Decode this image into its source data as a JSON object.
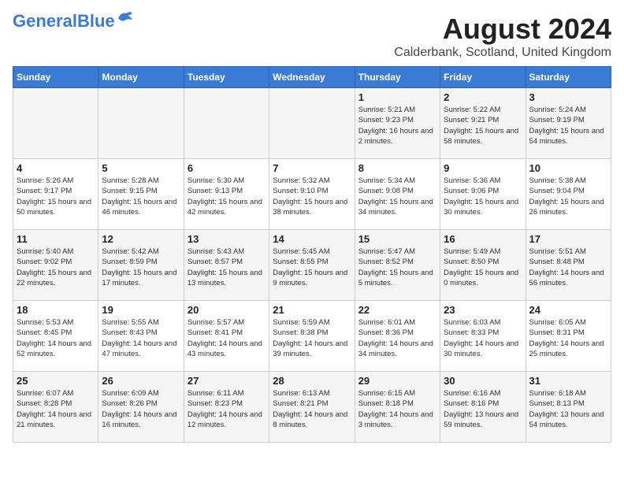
{
  "header": {
    "logo_general": "General",
    "logo_blue": "Blue",
    "month_title": "August 2024",
    "location": "Calderbank, Scotland, United Kingdom"
  },
  "weekdays": [
    "Sunday",
    "Monday",
    "Tuesday",
    "Wednesday",
    "Thursday",
    "Friday",
    "Saturday"
  ],
  "weeks": [
    [
      {
        "day": "",
        "sunrise": "",
        "sunset": "",
        "daylight": ""
      },
      {
        "day": "",
        "sunrise": "",
        "sunset": "",
        "daylight": ""
      },
      {
        "day": "",
        "sunrise": "",
        "sunset": "",
        "daylight": ""
      },
      {
        "day": "",
        "sunrise": "",
        "sunset": "",
        "daylight": ""
      },
      {
        "day": "1",
        "sunrise": "Sunrise: 5:21 AM",
        "sunset": "Sunset: 9:23 PM",
        "daylight": "Daylight: 16 hours and 2 minutes."
      },
      {
        "day": "2",
        "sunrise": "Sunrise: 5:22 AM",
        "sunset": "Sunset: 9:21 PM",
        "daylight": "Daylight: 15 hours and 58 minutes."
      },
      {
        "day": "3",
        "sunrise": "Sunrise: 5:24 AM",
        "sunset": "Sunset: 9:19 PM",
        "daylight": "Daylight: 15 hours and 54 minutes."
      }
    ],
    [
      {
        "day": "4",
        "sunrise": "Sunrise: 5:26 AM",
        "sunset": "Sunset: 9:17 PM",
        "daylight": "Daylight: 15 hours and 50 minutes."
      },
      {
        "day": "5",
        "sunrise": "Sunrise: 5:28 AM",
        "sunset": "Sunset: 9:15 PM",
        "daylight": "Daylight: 15 hours and 46 minutes."
      },
      {
        "day": "6",
        "sunrise": "Sunrise: 5:30 AM",
        "sunset": "Sunset: 9:13 PM",
        "daylight": "Daylight: 15 hours and 42 minutes."
      },
      {
        "day": "7",
        "sunrise": "Sunrise: 5:32 AM",
        "sunset": "Sunset: 9:10 PM",
        "daylight": "Daylight: 15 hours and 38 minutes."
      },
      {
        "day": "8",
        "sunrise": "Sunrise: 5:34 AM",
        "sunset": "Sunset: 9:08 PM",
        "daylight": "Daylight: 15 hours and 34 minutes."
      },
      {
        "day": "9",
        "sunrise": "Sunrise: 5:36 AM",
        "sunset": "Sunset: 9:06 PM",
        "daylight": "Daylight: 15 hours and 30 minutes."
      },
      {
        "day": "10",
        "sunrise": "Sunrise: 5:38 AM",
        "sunset": "Sunset: 9:04 PM",
        "daylight": "Daylight: 15 hours and 26 minutes."
      }
    ],
    [
      {
        "day": "11",
        "sunrise": "Sunrise: 5:40 AM",
        "sunset": "Sunset: 9:02 PM",
        "daylight": "Daylight: 15 hours and 22 minutes."
      },
      {
        "day": "12",
        "sunrise": "Sunrise: 5:42 AM",
        "sunset": "Sunset: 8:59 PM",
        "daylight": "Daylight: 15 hours and 17 minutes."
      },
      {
        "day": "13",
        "sunrise": "Sunrise: 5:43 AM",
        "sunset": "Sunset: 8:57 PM",
        "daylight": "Daylight: 15 hours and 13 minutes."
      },
      {
        "day": "14",
        "sunrise": "Sunrise: 5:45 AM",
        "sunset": "Sunset: 8:55 PM",
        "daylight": "Daylight: 15 hours and 9 minutes."
      },
      {
        "day": "15",
        "sunrise": "Sunrise: 5:47 AM",
        "sunset": "Sunset: 8:52 PM",
        "daylight": "Daylight: 15 hours and 5 minutes."
      },
      {
        "day": "16",
        "sunrise": "Sunrise: 5:49 AM",
        "sunset": "Sunset: 8:50 PM",
        "daylight": "Daylight: 15 hours and 0 minutes."
      },
      {
        "day": "17",
        "sunrise": "Sunrise: 5:51 AM",
        "sunset": "Sunset: 8:48 PM",
        "daylight": "Daylight: 14 hours and 56 minutes."
      }
    ],
    [
      {
        "day": "18",
        "sunrise": "Sunrise: 5:53 AM",
        "sunset": "Sunset: 8:45 PM",
        "daylight": "Daylight: 14 hours and 52 minutes."
      },
      {
        "day": "19",
        "sunrise": "Sunrise: 5:55 AM",
        "sunset": "Sunset: 8:43 PM",
        "daylight": "Daylight: 14 hours and 47 minutes."
      },
      {
        "day": "20",
        "sunrise": "Sunrise: 5:57 AM",
        "sunset": "Sunset: 8:41 PM",
        "daylight": "Daylight: 14 hours and 43 minutes."
      },
      {
        "day": "21",
        "sunrise": "Sunrise: 5:59 AM",
        "sunset": "Sunset: 8:38 PM",
        "daylight": "Daylight: 14 hours and 39 minutes."
      },
      {
        "day": "22",
        "sunrise": "Sunrise: 6:01 AM",
        "sunset": "Sunset: 8:36 PM",
        "daylight": "Daylight: 14 hours and 34 minutes."
      },
      {
        "day": "23",
        "sunrise": "Sunrise: 6:03 AM",
        "sunset": "Sunset: 8:33 PM",
        "daylight": "Daylight: 14 hours and 30 minutes."
      },
      {
        "day": "24",
        "sunrise": "Sunrise: 6:05 AM",
        "sunset": "Sunset: 8:31 PM",
        "daylight": "Daylight: 14 hours and 25 minutes."
      }
    ],
    [
      {
        "day": "25",
        "sunrise": "Sunrise: 6:07 AM",
        "sunset": "Sunset: 8:28 PM",
        "daylight": "Daylight: 14 hours and 21 minutes."
      },
      {
        "day": "26",
        "sunrise": "Sunrise: 6:09 AM",
        "sunset": "Sunset: 8:26 PM",
        "daylight": "Daylight: 14 hours and 16 minutes."
      },
      {
        "day": "27",
        "sunrise": "Sunrise: 6:11 AM",
        "sunset": "Sunset: 8:23 PM",
        "daylight": "Daylight: 14 hours and 12 minutes."
      },
      {
        "day": "28",
        "sunrise": "Sunrise: 6:13 AM",
        "sunset": "Sunset: 8:21 PM",
        "daylight": "Daylight: 14 hours and 8 minutes."
      },
      {
        "day": "29",
        "sunrise": "Sunrise: 6:15 AM",
        "sunset": "Sunset: 8:18 PM",
        "daylight": "Daylight: 14 hours and 3 minutes."
      },
      {
        "day": "30",
        "sunrise": "Sunrise: 6:16 AM",
        "sunset": "Sunset: 8:16 PM",
        "daylight": "Daylight: 13 hours and 59 minutes."
      },
      {
        "day": "31",
        "sunrise": "Sunrise: 6:18 AM",
        "sunset": "Sunset: 8:13 PM",
        "daylight": "Daylight: 13 hours and 54 minutes."
      }
    ]
  ]
}
